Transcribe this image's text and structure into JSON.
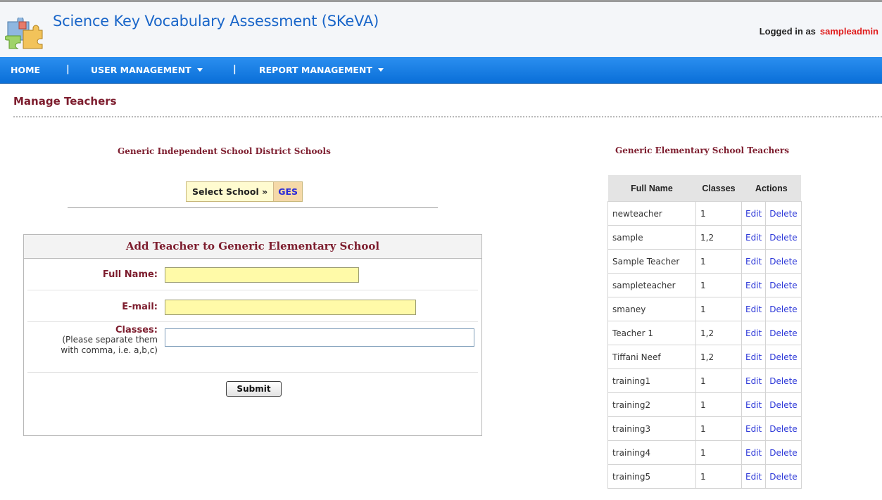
{
  "header": {
    "title": "Science Key Vocabulary Assessment (SKeVA)",
    "logged_in_label": "Logged in as",
    "username": "sampleadmin",
    "logo_icon": "puzzle-pieces-icon"
  },
  "nav": {
    "home": "HOME",
    "separator": "|",
    "user_management": "USER MANAGEMENT",
    "report_management": "REPORT MANAGEMENT"
  },
  "page": {
    "title": "Manage Teachers"
  },
  "schools": {
    "title": "Generic Independent School District Schools",
    "select_label": "Select School »",
    "selected_school": "GES"
  },
  "form": {
    "title": "Add Teacher to Generic Elementary School",
    "full_name_label": "Full Name:",
    "full_name_value": "",
    "email_label": "E-mail:",
    "email_value": "",
    "classes_label": "Classes:",
    "classes_hint_line1": "(Please separate them",
    "classes_hint_line2": "with comma, i.e. a,b,c)",
    "classes_value": "",
    "submit_label": "Submit"
  },
  "teachers": {
    "title": "Generic Elementary School Teachers",
    "columns": [
      "Full Name",
      "Classes",
      "Actions"
    ],
    "edit_label": "Edit",
    "delete_label": "Delete",
    "rows": [
      {
        "name": "newteacher",
        "classes": "1"
      },
      {
        "name": "sample",
        "classes": "1,2"
      },
      {
        "name": "Sample Teacher",
        "classes": "1"
      },
      {
        "name": "sampleteacher",
        "classes": "1"
      },
      {
        "name": "smaney",
        "classes": "1"
      },
      {
        "name": "Teacher 1",
        "classes": "1,2"
      },
      {
        "name": "Tiffani Neef",
        "classes": "1,2"
      },
      {
        "name": "training1",
        "classes": "1"
      },
      {
        "name": "training2",
        "classes": "1"
      },
      {
        "name": "training3",
        "classes": "1"
      },
      {
        "name": "training4",
        "classes": "1"
      },
      {
        "name": "training5",
        "classes": "1"
      }
    ]
  },
  "colors": {
    "nav_blue": "#0a6fd8",
    "title_blue": "#1a66c9",
    "maroon": "#7d1d2e",
    "username_red": "#e01b1b",
    "field_yellow": "#fffaa8",
    "link_blue": "#2d38d8"
  }
}
